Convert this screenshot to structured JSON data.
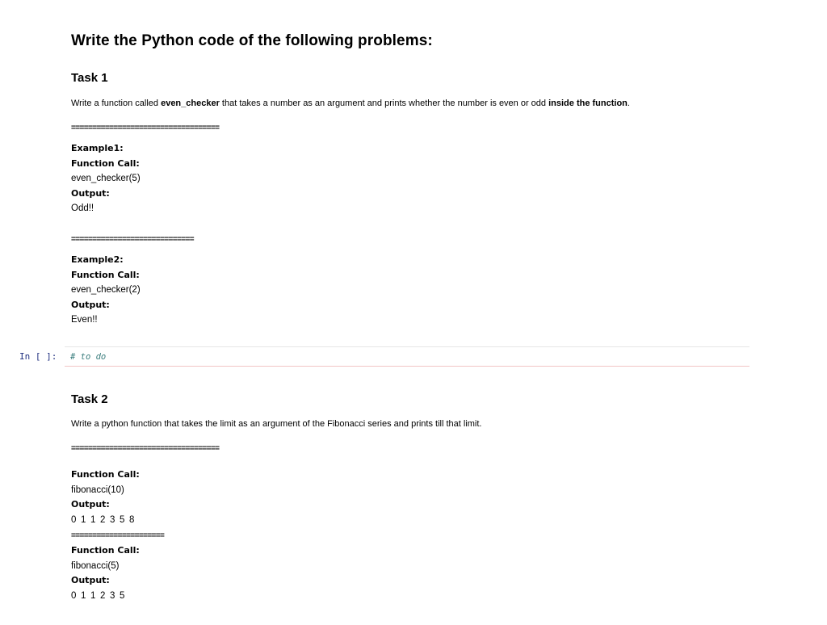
{
  "heading": "Write the Python code of the following problems:",
  "task1": {
    "title": "Task 1",
    "desc_prefix": "Write a function called ",
    "desc_fn": "even_checker",
    "desc_middle": " that takes a number as an argument and prints whether the number is even or odd ",
    "desc_bold": "inside the function",
    "desc_end": ".",
    "sep1": "===================================",
    "example1": {
      "label": "Example1:",
      "call_label": "Function Call:",
      "call": "even_checker(5)",
      "output_label": "Output:",
      "output": "Odd!!"
    },
    "sep2": "=============================",
    "example2": {
      "label": "Example2:",
      "call_label": "Function Call:",
      "call": "even_checker(2)",
      "output_label": "Output:",
      "output": "Even!!"
    }
  },
  "code_cell": {
    "prompt": "In [ ]:",
    "code": "# to do"
  },
  "task2": {
    "title": "Task 2",
    "desc": "Write a python function that takes the limit as an argument of the Fibonacci series and prints till that limit.",
    "sep1": "===================================",
    "ex1": {
      "call_label": "Function Call:",
      "call": "fibonacci(10)",
      "output_label": "Output:",
      "output": "0 1 1 2 3 5 8"
    },
    "sep2": "======================",
    "ex2": {
      "call_label": "Function Call:",
      "call": "fibonacci(5)",
      "output_label": "Output:",
      "output": "0 1 1 2 3 5"
    }
  }
}
